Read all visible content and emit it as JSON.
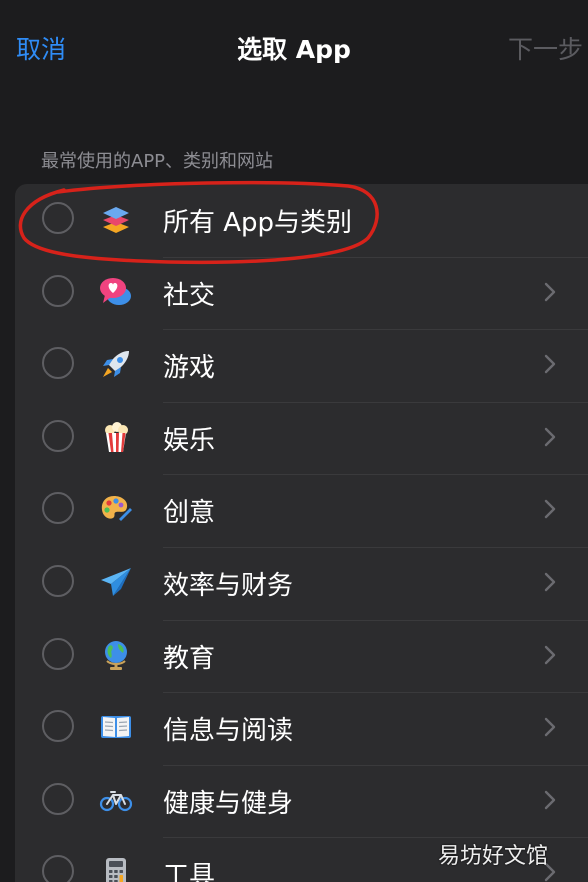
{
  "nav": {
    "cancel": "取消",
    "title": "选取 App",
    "next": "下一步"
  },
  "section_header": "最常使用的APP、类别和网站",
  "accent_color": "#2f8cf6",
  "highlight_color": "#d7221a",
  "items": [
    {
      "label": "所有 App与类别",
      "icon": "stack-layers-icon",
      "has_chevron": false
    },
    {
      "label": "社交",
      "icon": "speech-bubble-heart-icon",
      "has_chevron": true
    },
    {
      "label": "游戏",
      "icon": "rocket-icon",
      "has_chevron": true
    },
    {
      "label": "娱乐",
      "icon": "popcorn-icon",
      "has_chevron": true
    },
    {
      "label": "创意",
      "icon": "palette-icon",
      "has_chevron": true
    },
    {
      "label": "效率与财务",
      "icon": "paper-plane-icon",
      "has_chevron": true
    },
    {
      "label": "教育",
      "icon": "globe-icon",
      "has_chevron": true
    },
    {
      "label": "信息与阅读",
      "icon": "open-book-icon",
      "has_chevron": true
    },
    {
      "label": "健康与健身",
      "icon": "bicycle-icon",
      "has_chevron": true
    },
    {
      "label": "工具",
      "icon": "calculator-icon",
      "has_chevron": true
    }
  ],
  "watermark": "易坊好文馆"
}
